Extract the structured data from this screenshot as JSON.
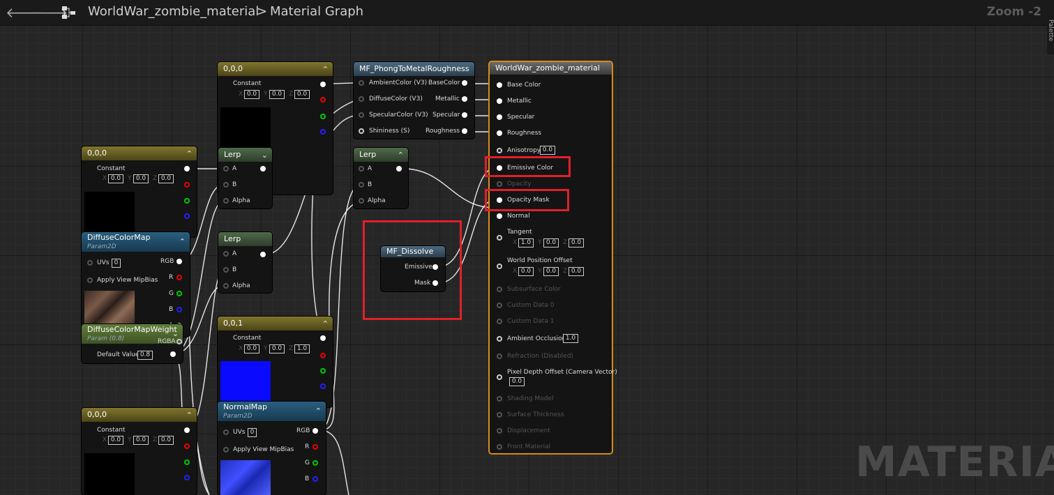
{
  "toolbar": {
    "back_arrow": "🡐",
    "forward_arrow": "🡒",
    "breadcrumb_root": "WorldWar_zombie_material",
    "breadcrumb_separator": ">",
    "breadcrumb_current": "Material Graph",
    "zoom": "Zoom -2",
    "side_tab": "Palette"
  },
  "nodes": {
    "const_top": {
      "title": "0,0,0",
      "label": "Constant",
      "x": "0.0",
      "y": "0.0",
      "z": "0.0"
    },
    "const_left1": {
      "title": "0,0,0",
      "label": "Constant",
      "x": "0.0",
      "y": "0.0",
      "z": "0.0"
    },
    "const_left2": {
      "title": "0,0,0",
      "label": "Constant",
      "x": "0.0",
      "y": "0.0",
      "z": "0.0"
    },
    "const_mid": {
      "title": "0,0,1",
      "label": "Constant",
      "x": "0.0",
      "y": "0.0",
      "z": "1.0"
    },
    "axis": {
      "x": "X",
      "y": "Y",
      "z": "Z"
    },
    "diffuse_map": {
      "title": "DiffuseColorMap",
      "subtitle": "Param2D",
      "uvs_label": "UVs",
      "uvs_value": "0",
      "mip": "Apply View MipBias",
      "out_rgb": "RGB",
      "out_r": "R",
      "out_g": "G",
      "out_b": "B",
      "out_a": "A",
      "out_rgba": "RGBA"
    },
    "diffuse_weight": {
      "title": "DiffuseColorMapWeight",
      "subtitle": "Param (0.8)",
      "default_label": "Default Value",
      "default_value": "0.8"
    },
    "normal_map": {
      "title": "NormalMap",
      "subtitle": "Param2D",
      "uvs_label": "UVs",
      "uvs_value": "0",
      "mip": "Apply View MipBias",
      "out_rgb": "RGB",
      "out_r": "R",
      "out_g": "G",
      "out_b": "B"
    },
    "lerp": {
      "title": "Lerp",
      "a": "A",
      "b": "B",
      "alpha": "Alpha"
    },
    "phong": {
      "title": "MF_PhongToMetalRoughness",
      "in1": "AmbientColor (V3)",
      "in2": "DiffuseColor (V3)",
      "in3": "SpecularColor (V3)",
      "in4": "Shininess (S)",
      "out1": "BaseColor",
      "out2": "Metallic",
      "out3": "Specular",
      "out4": "Roughness"
    },
    "dissolve": {
      "title": "MF_Dissolve",
      "out1": "Emissive",
      "out2": "Mask"
    },
    "material": {
      "title": "WorldWar_zombie_material",
      "base_color": "Base Color",
      "metallic": "Metallic",
      "specular": "Specular",
      "roughness": "Roughness",
      "anisotropy": "Anisotropy",
      "anisotropy_value": "0.0",
      "emissive": "Emissive Color",
      "opacity": "Opacity",
      "opacity_mask": "Opacity Mask",
      "normal": "Normal",
      "tangent": "Tangent",
      "tangent_x": "1.0",
      "tangent_y": "0.0",
      "tangent_z": "0.0",
      "wpo": "World Position Offset",
      "wpo_x": "0.0",
      "wpo_y": "0.0",
      "wpo_z": "0.0",
      "subsurface": "Subsurface Color",
      "custom0": "Custom Data 0",
      "custom1": "Custom Data 1",
      "ao": "Ambient Occlusion",
      "ao_value": "1.0",
      "refraction": "Refraction (Disabled)",
      "pdo": "Pixel Depth Offset (Camera Vector)",
      "pdo_value": "0.0",
      "shading": "Shading Model",
      "thickness": "Surface Thickness",
      "displacement": "Displacement",
      "front": "Front Material"
    }
  },
  "watermark": "MATERIAL",
  "colors": {
    "accent": "#d88a1c",
    "highlight": "#e0202a"
  }
}
